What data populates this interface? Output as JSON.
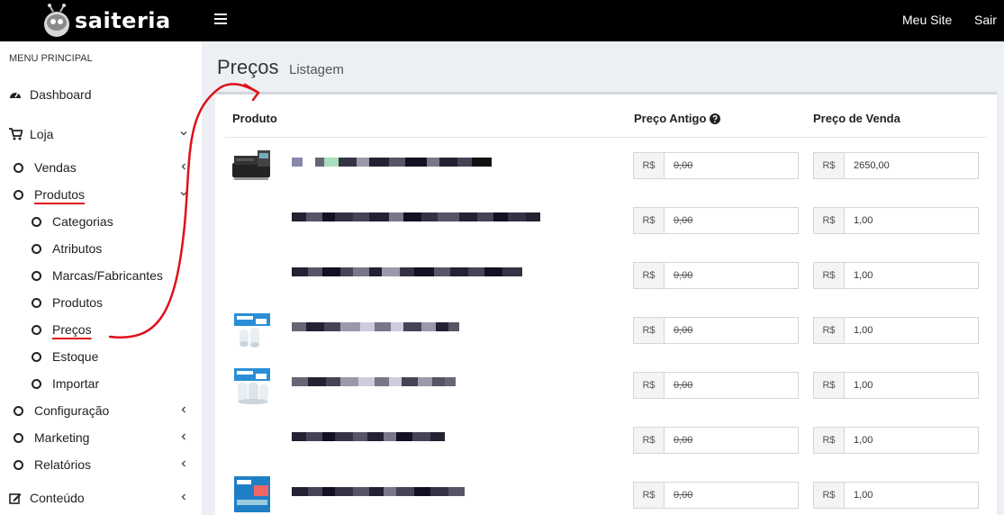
{
  "brand": {
    "name": "saiteria"
  },
  "topnav": {
    "site": "Meu Site",
    "exit": "Sair"
  },
  "sidebar": {
    "header": "MENU PRINCIPAL",
    "items": [
      {
        "label": "Dashboard",
        "icon": "dashboard-icon"
      },
      {
        "label": "Loja",
        "icon": "cart-icon"
      },
      {
        "label": "Vendas"
      },
      {
        "label": "Produtos"
      },
      {
        "label": "Categorias"
      },
      {
        "label": "Atributos"
      },
      {
        "label": "Marcas/Fabricantes"
      },
      {
        "label": "Produtos"
      },
      {
        "label": "Preços"
      },
      {
        "label": "Estoque"
      },
      {
        "label": "Importar"
      },
      {
        "label": "Configuração"
      },
      {
        "label": "Marketing"
      },
      {
        "label": "Relatórios"
      },
      {
        "label": "Conteúdo",
        "icon": "edit-icon"
      }
    ]
  },
  "page": {
    "title": "Preços",
    "subtitle": "Listagem"
  },
  "table": {
    "columns": {
      "product": "Produto",
      "old_price": "Preço Antigo",
      "sale_price": "Preço de Venda"
    },
    "currency": "R$",
    "rows": [
      {
        "old": "0,00",
        "sale": "2650,00"
      },
      {
        "old": "0,00",
        "sale": "1,00"
      },
      {
        "old": "0,00",
        "sale": "1,00"
      },
      {
        "old": "0,00",
        "sale": "1,00"
      },
      {
        "old": "0,00",
        "sale": "1,00"
      },
      {
        "old": "0,00",
        "sale": "1,00"
      },
      {
        "old": "0,00",
        "sale": "1,00"
      }
    ]
  },
  "colors": {
    "topbar": "#000000",
    "annotation": "#e0101a",
    "background": "#ecf0f5"
  }
}
